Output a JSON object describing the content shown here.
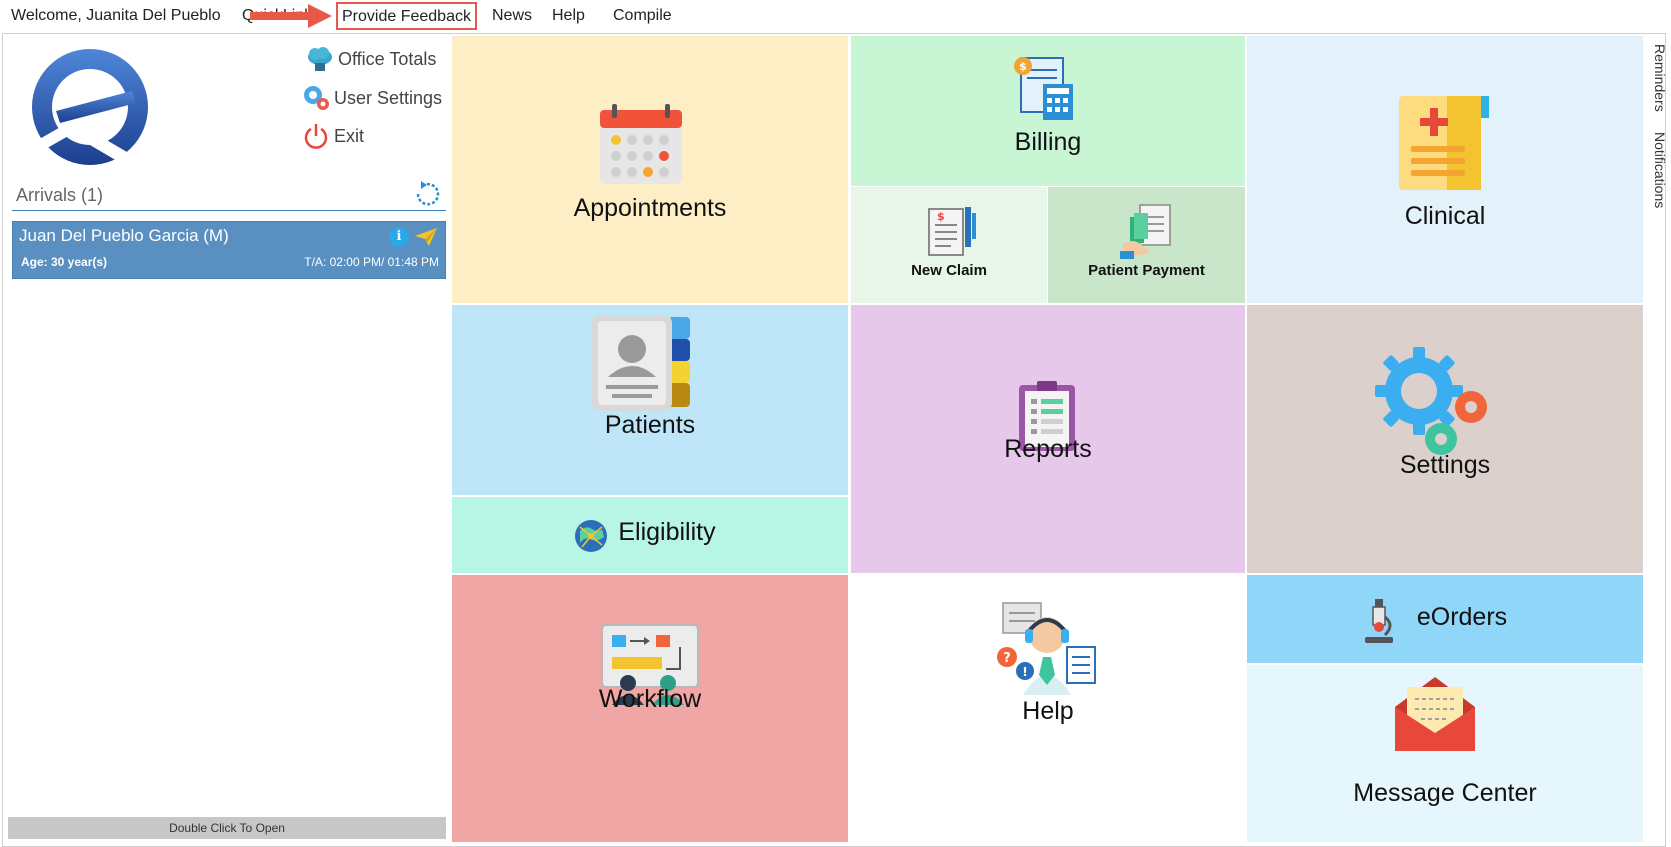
{
  "menu": {
    "welcome": "Welcome, Juanita Del Pueblo",
    "quicklinks": "QuickLinks",
    "feedback": "Provide Feedback",
    "news": "News",
    "help": "Help",
    "compile": "Compile"
  },
  "quick_links": {
    "office_totals": "Office Totals",
    "user_settings": "User Settings",
    "exit": "Exit"
  },
  "arrivals": {
    "title": "Arrivals (1)",
    "items": [
      {
        "name": "Juan Del Pueblo Garcia (M)",
        "age": "Age: 30 year(s)",
        "time": "T/A: 02:00 PM/ 01:48 PM"
      }
    ],
    "footer": "Double Click To Open"
  },
  "tiles": {
    "appointments": "Appointments",
    "billing": "Billing",
    "new_claim": "New Claim",
    "patient_payment": "Patient Payment",
    "clinical": "Clinical",
    "patients": "Patients",
    "eligibility": "Eligibility",
    "reports": "Reports",
    "settings": "Settings",
    "workflow": "Workflow",
    "help": "Help",
    "eorders": "eOrders",
    "message_center": "Message Center"
  },
  "side_tabs": {
    "reminders": "Reminders",
    "notifications": "Notifications"
  },
  "colors": {
    "appointments": "#fdeec5",
    "billing": "#c8f5d4",
    "clinical": "#e3f1fb",
    "patients": "#bfe5f8",
    "eligibility": "#b7f5e5",
    "reports": "#e6c9ea",
    "settings": "#dcd0cc",
    "workflow": "#f0a6a4",
    "eorders": "#8fd6f8",
    "message_center": "#e6f6fd",
    "arrival_row": "#5a8fc2",
    "highlight": "#e45a4c"
  }
}
